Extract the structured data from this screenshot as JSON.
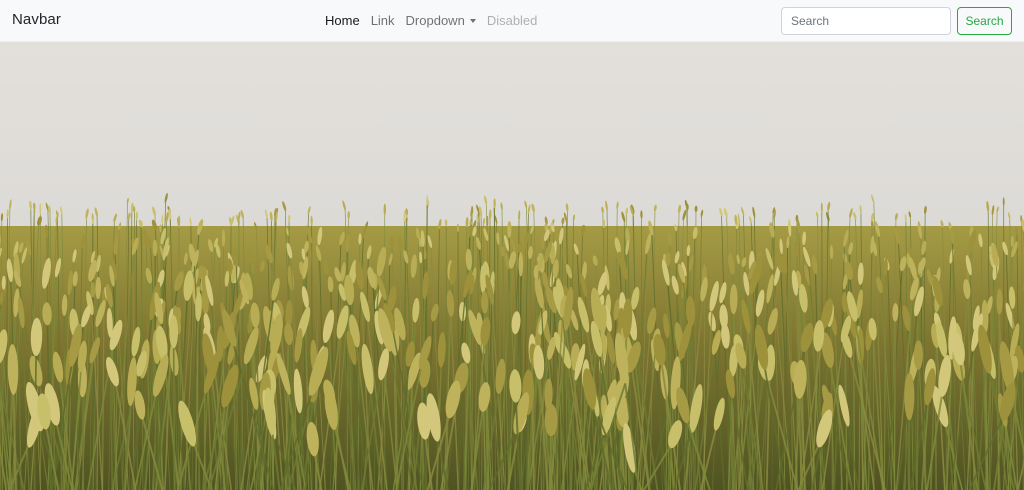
{
  "navbar": {
    "brand": "Navbar",
    "links": [
      {
        "label": "Home",
        "state": "active"
      },
      {
        "label": "Link",
        "state": "default"
      },
      {
        "label": "Dropdown",
        "state": "default"
      },
      {
        "label": "Disabled",
        "state": "disabled"
      }
    ],
    "search": {
      "placeholder": "Search",
      "button_label": "Search"
    }
  },
  "hero": {
    "image": "wheat-field-photo"
  },
  "colors": {
    "navbar_bg": "#f8f9fa",
    "brand_text": "#212529",
    "success": "#28a745",
    "sky": "#e0ddd9",
    "wheat_light": "#c9c06a",
    "wheat_dark": "#8c7f2c"
  }
}
